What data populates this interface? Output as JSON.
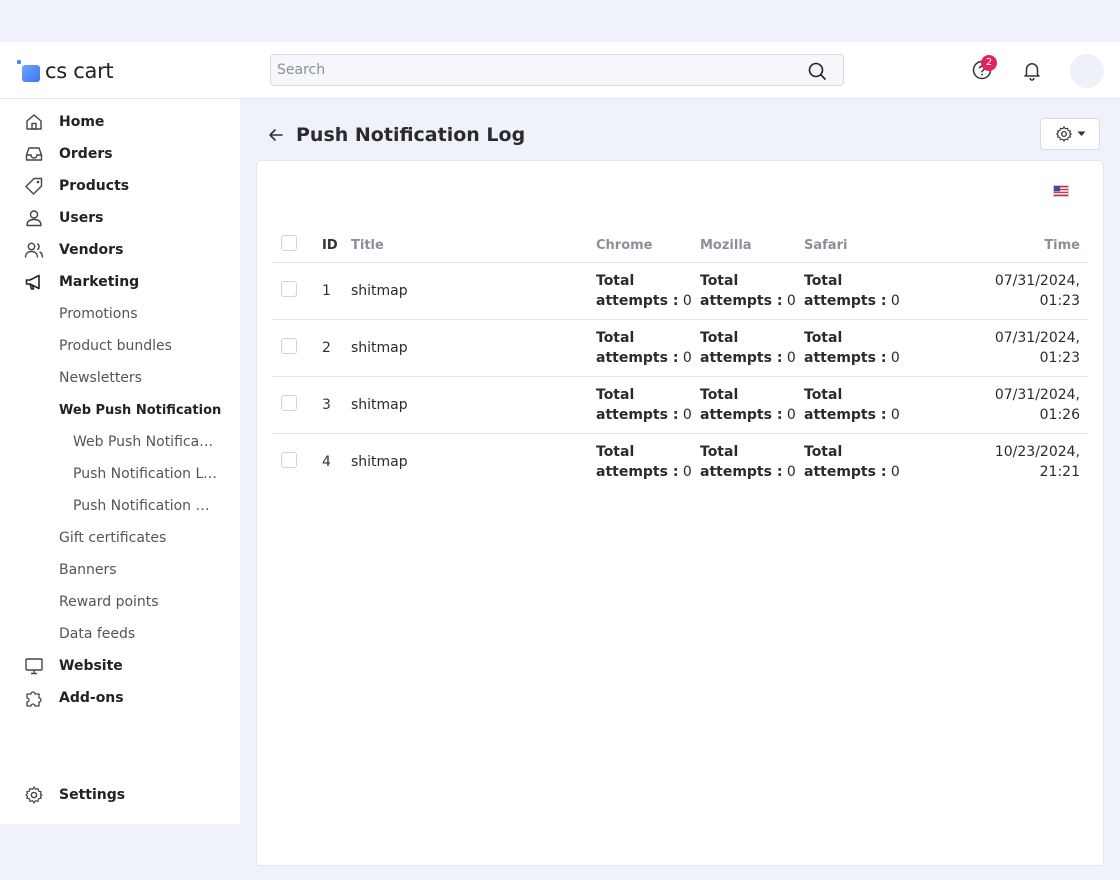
{
  "app": {
    "logo_text": "cs cart"
  },
  "header": {
    "search_placeholder": "Search",
    "help_badge_count": "2"
  },
  "sidebar": {
    "items": [
      {
        "label": "Home",
        "icon": "home-icon"
      },
      {
        "label": "Orders",
        "icon": "inbox-icon"
      },
      {
        "label": "Products",
        "icon": "tag-icon"
      },
      {
        "label": "Users",
        "icon": "user-icon"
      },
      {
        "label": "Vendors",
        "icon": "users-icon"
      },
      {
        "label": "Marketing",
        "icon": "megaphone-icon"
      }
    ],
    "marketing_sub": [
      {
        "label": "Promotions"
      },
      {
        "label": "Product bundles"
      },
      {
        "label": "Newsletters"
      },
      {
        "label": "Web Push Notification"
      }
    ],
    "webpush_sub": [
      {
        "label": "Web Push Notification"
      },
      {
        "label": "Push Notification Log"
      },
      {
        "label": "Push Notification Subscribers"
      }
    ],
    "marketing_sub2": [
      {
        "label": "Gift certificates"
      },
      {
        "label": "Banners"
      },
      {
        "label": "Reward points"
      },
      {
        "label": "Data feeds"
      }
    ],
    "bottom_items": [
      {
        "label": "Website",
        "icon": "monitor-icon"
      },
      {
        "label": "Add-ons",
        "icon": "puzzle-icon"
      }
    ],
    "settings_label": "Settings"
  },
  "page": {
    "title": "Push Notification Log"
  },
  "table": {
    "headers": {
      "id": "ID",
      "title": "Title",
      "chrome": "Chrome",
      "mozilla": "Mozilla",
      "safari": "Safari",
      "time": "Time"
    },
    "attempt_label_1": "Total",
    "attempt_label_2": "attempts :",
    "rows": [
      {
        "id": "1",
        "title": "shitmap",
        "chrome": "0",
        "mozilla": "0",
        "safari": "0",
        "date": "07/31/2024,",
        "time": "01:23"
      },
      {
        "id": "2",
        "title": "shitmap",
        "chrome": "0",
        "mozilla": "0",
        "safari": "0",
        "date": "07/31/2024,",
        "time": "01:23"
      },
      {
        "id": "3",
        "title": "shitmap",
        "chrome": "0",
        "mozilla": "0",
        "safari": "0",
        "date": "07/31/2024,",
        "time": "01:26"
      },
      {
        "id": "4",
        "title": "shitmap",
        "chrome": "0",
        "mozilla": "0",
        "safari": "0",
        "date": "10/23/2024,",
        "time": "21:21"
      }
    ]
  },
  "colors": {
    "background": "#eff2fa",
    "badge": "#e0245e",
    "logo": "#4f86f7"
  }
}
